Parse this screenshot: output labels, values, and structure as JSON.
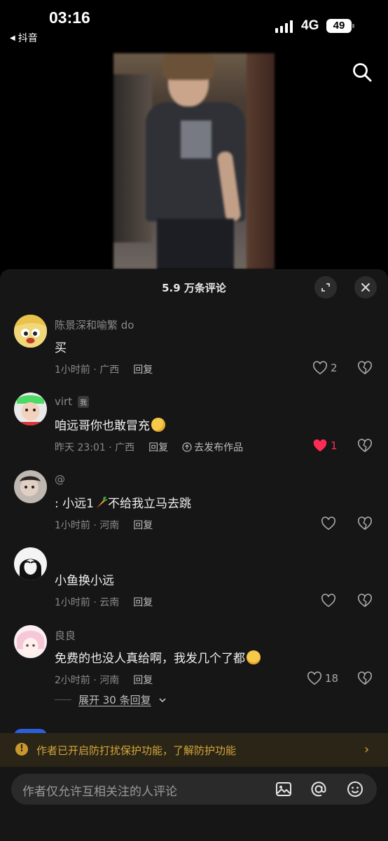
{
  "status": {
    "time": "03:16",
    "back_app": "抖音",
    "network": "4G",
    "battery": "49"
  },
  "sheet": {
    "title": "5.9 万条评论"
  },
  "comments": [
    {
      "name": "陈景深和喻繁 do",
      "badge": "",
      "text": "买",
      "time": "1小时前 · 广西",
      "reply": "回复",
      "likes": "2",
      "liked": false
    },
    {
      "name": "virt",
      "badge": "我",
      "text": "咱远哥你也敢冒充",
      "time": "昨天 23:01 · 广西",
      "reply": "回复",
      "publish": "去发布作品",
      "likes": "1",
      "liked": true
    },
    {
      "name": "@",
      "badge": "",
      "text": ": 小远1",
      "text_after": "不给我立马去跳",
      "time": "1小时前 · 河南",
      "reply": "回复",
      "likes": "",
      "liked": false
    },
    {
      "name": "",
      "badge": "",
      "text": "小鱼换小远",
      "time": "1小时前 · 云南",
      "reply": "回复",
      "likes": "",
      "liked": false
    },
    {
      "name": "良良",
      "badge": "",
      "text": "免费的也没人真给啊，我发几个了都",
      "time": "2小时前 · 河南",
      "reply": "回复",
      "likes": "18",
      "liked": false
    }
  ],
  "expand_replies": "展开 30 条回复",
  "banner": {
    "text": "作者已开启防打扰保护功能，了解防护功能"
  },
  "input": {
    "placeholder": "作者仅允许互相关注的人评论"
  },
  "colors": {
    "like_active": "#fe2c55",
    "banner_text": "#d3a53c",
    "sheet_bg": "#161616"
  },
  "icons": [
    "search-icon",
    "expand-icon",
    "close-icon",
    "heart-icon",
    "broken-heart-icon",
    "image-icon",
    "at-icon",
    "emoji-icon",
    "chevron-right-icon",
    "chevron-down-icon",
    "info-icon"
  ]
}
